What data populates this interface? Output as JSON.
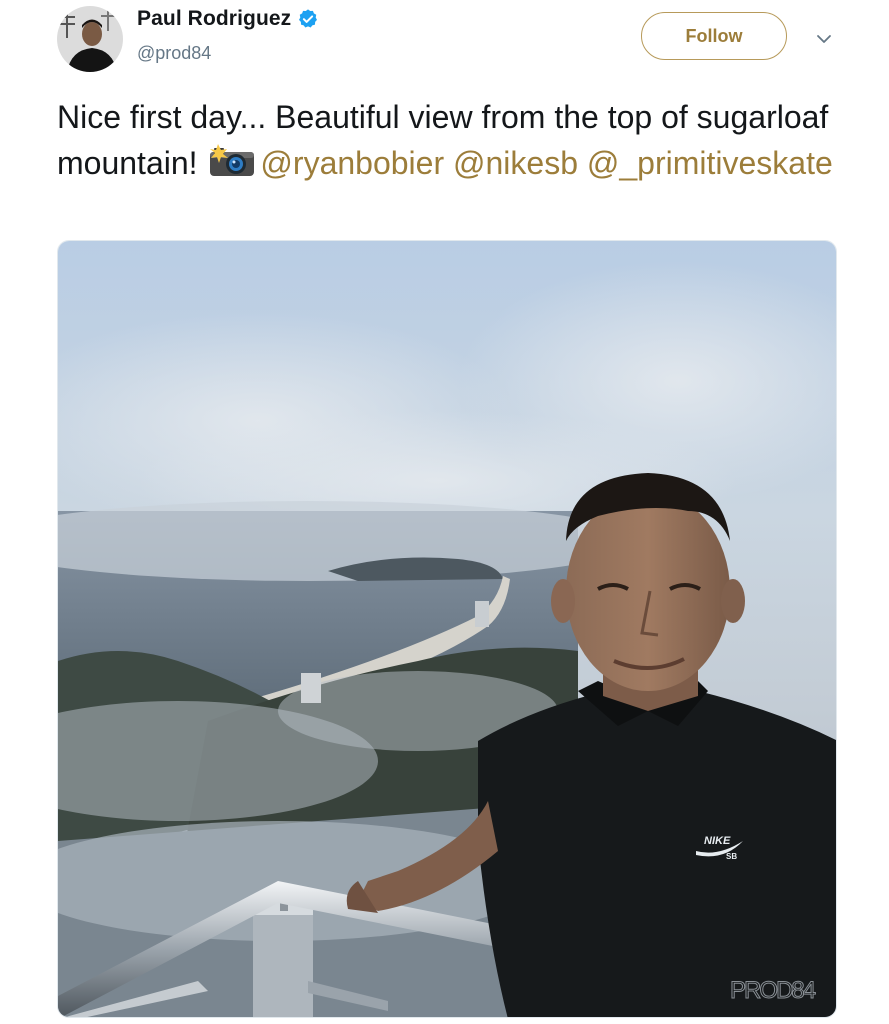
{
  "author": {
    "display_name": "Paul Rodriguez",
    "handle": "@prod84",
    "verified": true,
    "avatar_icon": "profile-photo"
  },
  "actions": {
    "follow_label": "Follow",
    "menu_icon": "chevron-down-icon"
  },
  "tweet": {
    "text_part1": "Nice first day... Beautiful view from the top of sugarloaf mountain! ",
    "emoji": "camera-with-flash",
    "mentions": [
      "@ryanbobier",
      "@nikesb",
      "@_primitiveskate"
    ]
  },
  "media": {
    "shirt_logo_line1": "NIKE",
    "shirt_logo_line2": "SB",
    "watermark": "PROD84"
  },
  "colors": {
    "accent": "#9c7d3a",
    "text": "#14171a",
    "muted": "#657786",
    "verified": "#1da1f2"
  }
}
